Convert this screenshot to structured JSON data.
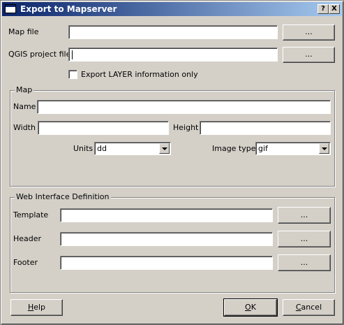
{
  "window": {
    "title": "Export to Mapserver",
    "help_glyph": "?",
    "close_glyph": "X"
  },
  "top": {
    "map_file_label": "Map file",
    "qgis_project_label": "QGIS project file",
    "browse_label": "...",
    "export_layer_only_label": "Export LAYER information only",
    "map_file_value": "",
    "qgis_project_value": ""
  },
  "map_group": {
    "title": "Map",
    "name_label": "Name",
    "width_label": "Width",
    "height_label": "Height",
    "units_label": "Units",
    "units_value": "dd",
    "image_type_label": "Image type",
    "image_type_value": "gif"
  },
  "web_group": {
    "title": "Web Interface Definition",
    "template_label": "Template",
    "header_label": "Header",
    "footer_label": "Footer",
    "browse_label": "..."
  },
  "footer_buttons": {
    "help_accel": "H",
    "help_rest": "elp",
    "ok_accel": "O",
    "ok_rest": "K",
    "cancel_accel": "C",
    "cancel_rest": "ancel"
  },
  "icons": [
    "window-icon",
    "help-icon",
    "close-icon",
    "dropdown-arrow-icon"
  ]
}
